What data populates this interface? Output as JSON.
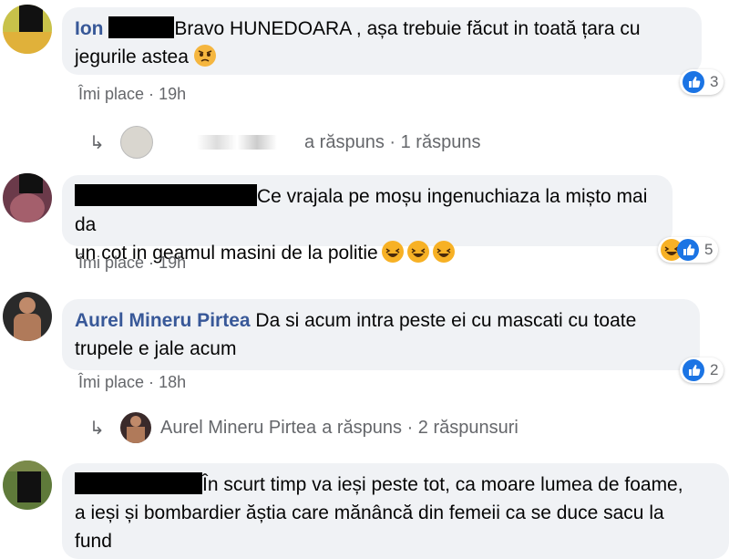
{
  "comments": [
    {
      "author": "Ion",
      "text_line1": "Bravo HUNEDOARA , așa trebuie făcut in toată țara cu",
      "text_line2": "jegurile astea",
      "emoji": "angry-emoji",
      "like_label": "Îmi place",
      "time": "19h",
      "reaction_count": "3",
      "reply_text": "a răspuns · 1 răspuns"
    },
    {
      "text_line1": "Ce vrajala pe moșu ingenuchiaza la mișto mai da",
      "text_line2": "un cot in geamul masini de la politie",
      "emoji": "laughing-emoji",
      "like_label": "Îmi place",
      "time": "19h",
      "reaction_count": "5"
    },
    {
      "author": "Aurel Mineru Pirtea",
      "text_line1": "Da si acum intra peste ei cu mascati cu toate",
      "text_line2": "trupele e jale acum",
      "like_label": "Îmi place",
      "time": "18h",
      "reaction_count": "2",
      "reply_author": "Aurel Mineru Pirtea",
      "reply_text": "a răspuns · 2 răspunsuri"
    },
    {
      "text_line1": "În scurt timp va ieși peste tot, ca moare lumea de foame,",
      "text_line2": "a ieși și bombardier ăștia care mănâncă din femeii ca se duce sacu la",
      "text_line3": "fund"
    }
  ],
  "separator": "·",
  "colors": {
    "bubble": "#f0f2f5",
    "name": "#385898",
    "like": "#1b74e4",
    "haha": "#f7b125",
    "meta": "#65676b"
  }
}
